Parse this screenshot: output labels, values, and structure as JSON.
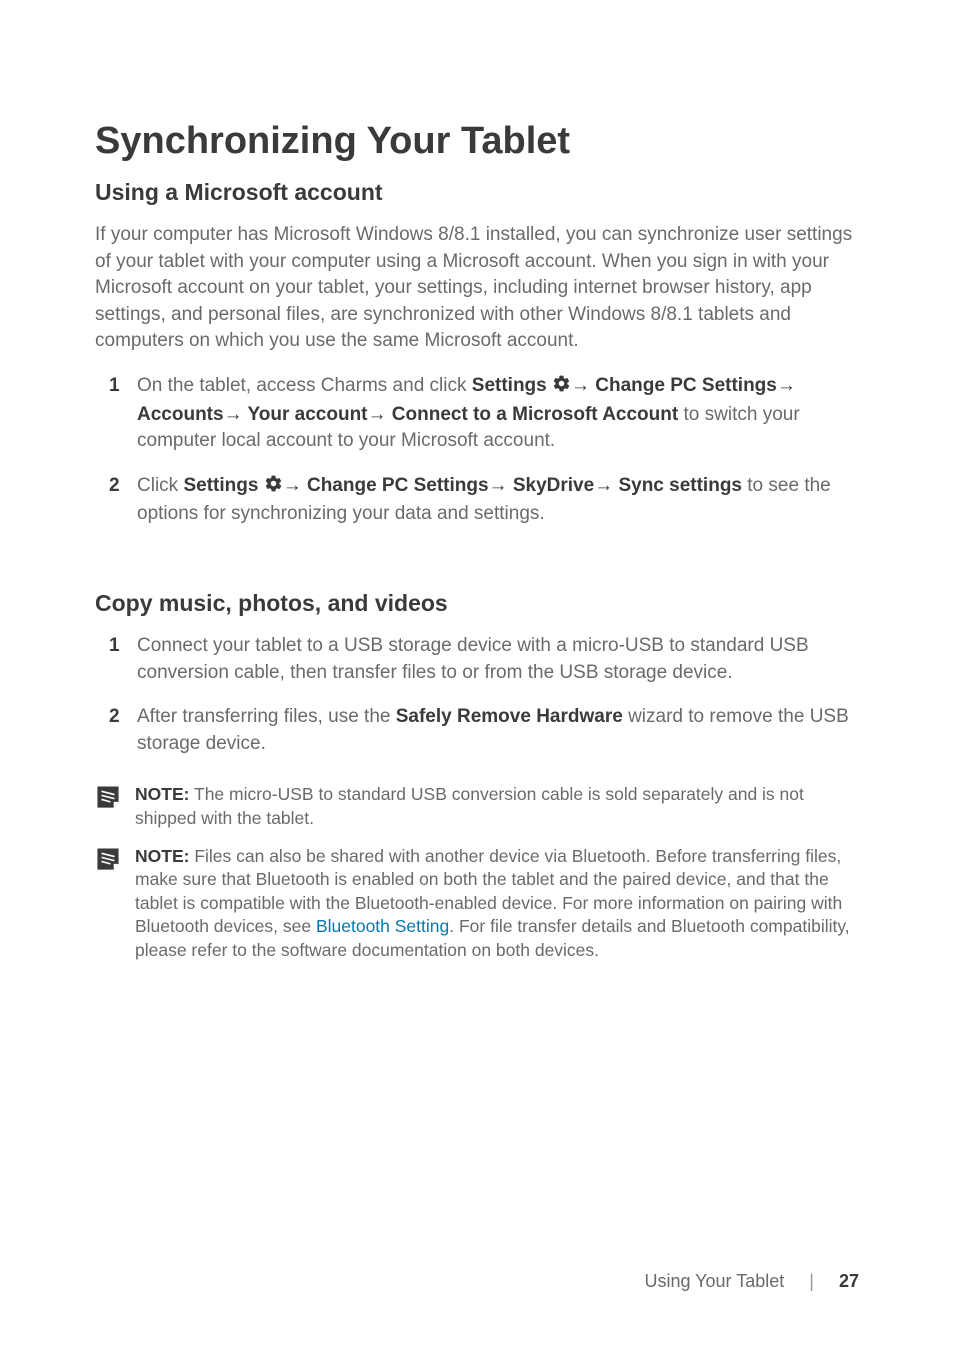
{
  "heading_main": "Synchronizing Your Tablet",
  "section1": {
    "title": "Using a Microsoft account",
    "intro": "If your computer has Microsoft Windows 8/8.1 installed, you can synchronize user settings of your tablet with your computer using a Microsoft account. When you sign in with your Microsoft account on your tablet, your settings, including internet browser history, app settings, and personal files, are synchronized with other Windows 8/8.1 tablets and computers on which you use the same Microsoft account.",
    "items": {
      "0": {
        "num": "1",
        "pre": "On the tablet, access Charms and click ",
        "b1": "Settings ",
        "arrow1": "→ ",
        "b2": "Change PC Settings",
        "arrow2": "→ ",
        "b3": "Accounts",
        "arrow3": "→ ",
        "b4": "Your account",
        "arrow4": "→ ",
        "b5": "Connect to a Microsoft Account",
        "tail": " to switch your computer local account to your Microsoft account."
      },
      "1": {
        "num": "2",
        "pre": "Click ",
        "b1": "Settings ",
        "arrow1": "→ ",
        "b2": "Change PC Settings",
        "arrow2": "→ ",
        "b3": "SkyDrive",
        "arrow3": "→ ",
        "b4": "Sync settings",
        "tail": " to see the options for synchronizing your data and settings."
      }
    }
  },
  "section2": {
    "title": "Copy music, photos, and videos",
    "items": {
      "0": {
        "num": "1",
        "text": "Connect your tablet to a USB storage device with a micro-USB to standard USB conversion cable, then transfer files to or from the USB storage device."
      },
      "1": {
        "num": "2",
        "pre": "After transferring files, use the ",
        "b1": "Safely Remove Hardware",
        "tail": " wizard to remove the USB storage device."
      }
    },
    "notes": {
      "0": {
        "label": "NOTE:",
        "text": " The micro-USB to standard USB conversion cable is sold separately and is not shipped with the tablet."
      },
      "1": {
        "label": "NOTE:",
        "pre": " Files can also be shared with another device via Bluetooth. Before transferring files, make sure that Bluetooth is enabled on both the tablet and the paired device, and that the tablet is compatible with the Bluetooth-enabled device. For more information on pairing with Bluetooth devices, see ",
        "link": "Bluetooth Setting",
        "tail": ". For file transfer details and Bluetooth compatibility, please refer to the software documentation on both devices."
      }
    }
  },
  "footer": {
    "section": "Using Your Tablet",
    "sep": "|",
    "page": "27"
  }
}
